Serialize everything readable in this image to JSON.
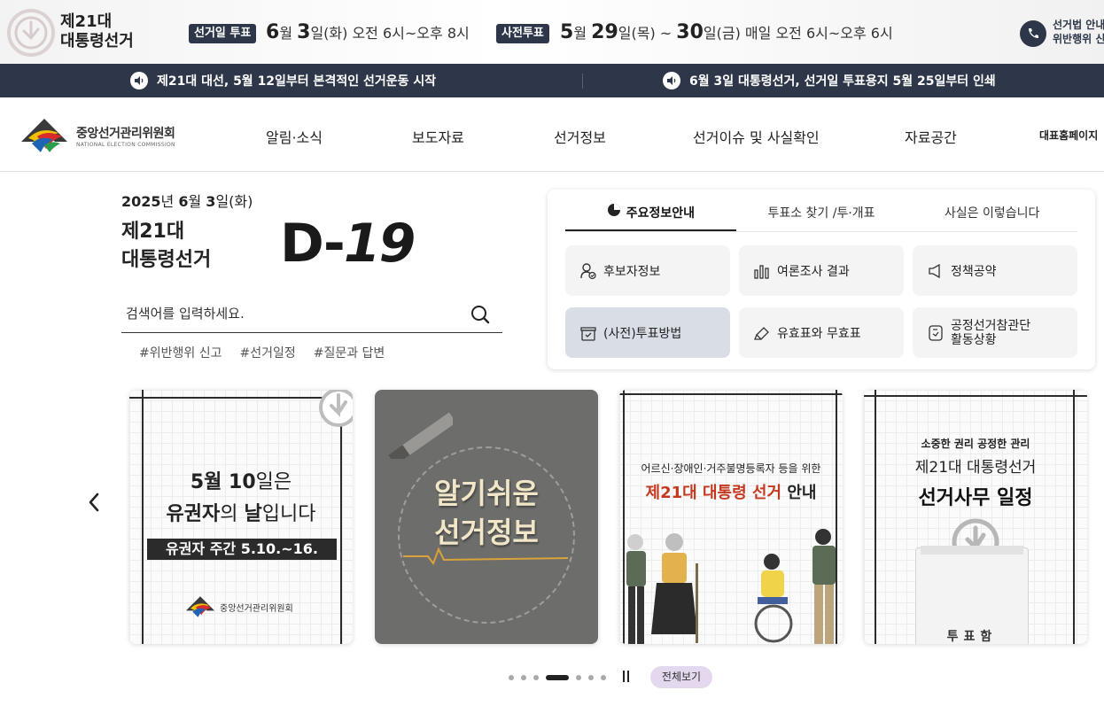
{
  "top_bar": {
    "title_line1": "제21대",
    "title_line2": "대통령선거",
    "election_label": "선거일 투표",
    "election_month": "6",
    "election_month_unit": "월",
    "election_day": "3",
    "election_day_rest": "일(화) 오전 6시~오후 8시",
    "early_label": "사전투표",
    "early_month": "5",
    "early_month_unit": "월",
    "early_day1": "29",
    "early_mid": "일(목) ~",
    "early_day2": "30",
    "early_rest": "일(금) 매일 오전 6시~오후 6시",
    "call_line1": "선거법 안내",
    "call_line2": "위반행위 신"
  },
  "notices": [
    {
      "text": "제21대 대선, 5월 12일부터 본격적인 선거운동 시작"
    },
    {
      "text": "6월 3일 대통령선거, 선거일 투표용지 5월 25일부터 인쇄"
    }
  ],
  "brand": {
    "name_ko": "중앙선거관리위원회",
    "name_en": "NATIONAL ELECTION COMMISSION"
  },
  "nav": {
    "items": [
      "알림·소식",
      "보도자료",
      "선거정보",
      "선거이슈 및 사실확인",
      "자료공간"
    ],
    "homepage": "대표홈페이지"
  },
  "dday": {
    "date_year": "2025",
    "date_year_unit": "년 ",
    "date_month": "6",
    "date_month_unit": "월 ",
    "date_day": "3",
    "date_day_unit": "일(화)",
    "name_line1": "제21대",
    "name_line2": "대통령선거",
    "prefix": "D-",
    "count": "19"
  },
  "search": {
    "placeholder": "검색어를 입력하세요.",
    "tags": [
      "#위반행위 신고",
      "#선거일정",
      "#질문과 답변"
    ]
  },
  "panel": {
    "tabs": [
      "주요정보안내",
      "투표소 찾기 /투·개표",
      "사실은 이렇습니다"
    ],
    "active_tab": 0,
    "buttons": [
      {
        "label": "후보자정보",
        "icon": "candidate-icon"
      },
      {
        "label": "여론조사 결과",
        "icon": "bar-chart-icon"
      },
      {
        "label": "정책공약",
        "icon": "megaphone-icon"
      },
      {
        "label": "(사전)투표방법",
        "icon": "ballot-box-icon"
      },
      {
        "label": "유효표와 무효표",
        "icon": "eraser-icon"
      },
      {
        "label": "공정선거참관단 활동상황",
        "icon": "document-icon"
      }
    ],
    "selected_button": 3
  },
  "carousel": {
    "card1": {
      "line1_a": "5월 ",
      "line1_b": "10",
      "line1_c": "일은",
      "line2_a": "유권자",
      "line2_b": "의 ",
      "line2_c": "날",
      "line2_d": "입니다",
      "banner": "유권자 주간  5.10.~16.",
      "logo_text": "중앙선거관리위원회"
    },
    "card2": {
      "line1": "알기쉬운",
      "line2": "선거정보"
    },
    "card3": {
      "sub": "어르신·장애인·거주불명등록자 등을 위한",
      "main_red": "제21대 대통령 선거",
      "main_rest": " 안내"
    },
    "card4": {
      "line1": "소중한 권리 공정한 관리",
      "line2": "제21대 대통령선거",
      "line3": "선거사무 일정",
      "box_label": "투표함"
    },
    "dots": 7,
    "active_dot": 3,
    "view_all": "전체보기"
  },
  "colors": {
    "navy": "#2d3749",
    "accent_red": "#c3381f",
    "view_all_bg": "#e4d8ef"
  }
}
